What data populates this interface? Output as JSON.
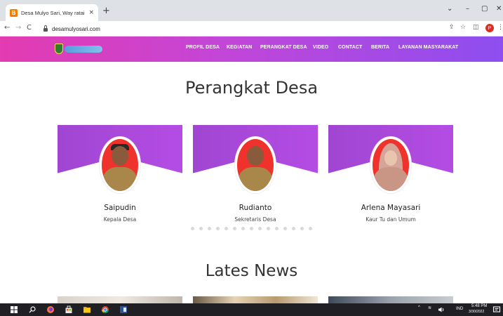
{
  "browser": {
    "tab_title": "Desa Mulyo Sari, Way ratai",
    "tab_close": "×",
    "new_tab": "+",
    "url": "desamulyosari.com",
    "profile_initial": "P",
    "back": "←",
    "forward": "→",
    "reload": "C",
    "share": "⇪",
    "bookmark": "☆",
    "sidepanel": "◫",
    "menu": "⋮",
    "win_minimize": "–",
    "win_restore": "▢",
    "win_close": "✕",
    "tablist": "⌄"
  },
  "navbar": {
    "items": [
      "PROFIL DESA",
      "KEGIATAN",
      "PERANGKAT DESA",
      "VIDEO",
      "CONTACT",
      "BERITA",
      "LAYANAN MASYARAKAT"
    ]
  },
  "section": {
    "title": "Perangkat Desa"
  },
  "staff": [
    {
      "name": "Saipudin",
      "role": "Kepala Desa"
    },
    {
      "name": "Rudianto",
      "role": "Sekretaris Desa"
    },
    {
      "name": "Arlena Mayasari",
      "role": "Kaur Tu dan Umum"
    }
  ],
  "carousel": {
    "dot_count": 15
  },
  "news": {
    "title": "Lates News"
  },
  "taskbar": {
    "language": "IND",
    "time": "5:48 PM",
    "date": "3/30/2022",
    "tray_up": "^",
    "wifi": "≋"
  },
  "colors": {
    "navbar_start": "#e33bb0",
    "navbar_end": "#8d4ef0",
    "card_banner": "#a046d2",
    "avatar_bg": "#f0322d"
  }
}
